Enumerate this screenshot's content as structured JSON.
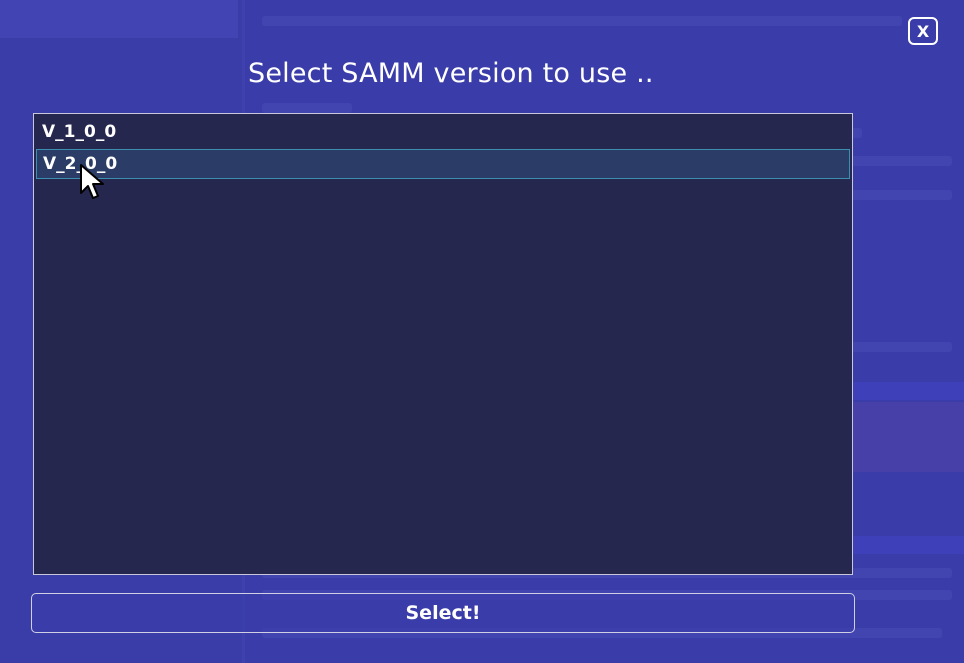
{
  "dialog": {
    "title": "Select SAMM version to use ..",
    "close_label": "X",
    "versions": [
      {
        "label": "V_1_0_0",
        "selected": false
      },
      {
        "label": "V_2_0_0",
        "selected": true
      }
    ],
    "select_label": "Select!"
  },
  "colors": {
    "background": "#3b3fa8",
    "list_background": "#26274f",
    "selected_item": "#2b3d66",
    "selected_border": "#3d8fb0",
    "text": "#ffffff"
  }
}
